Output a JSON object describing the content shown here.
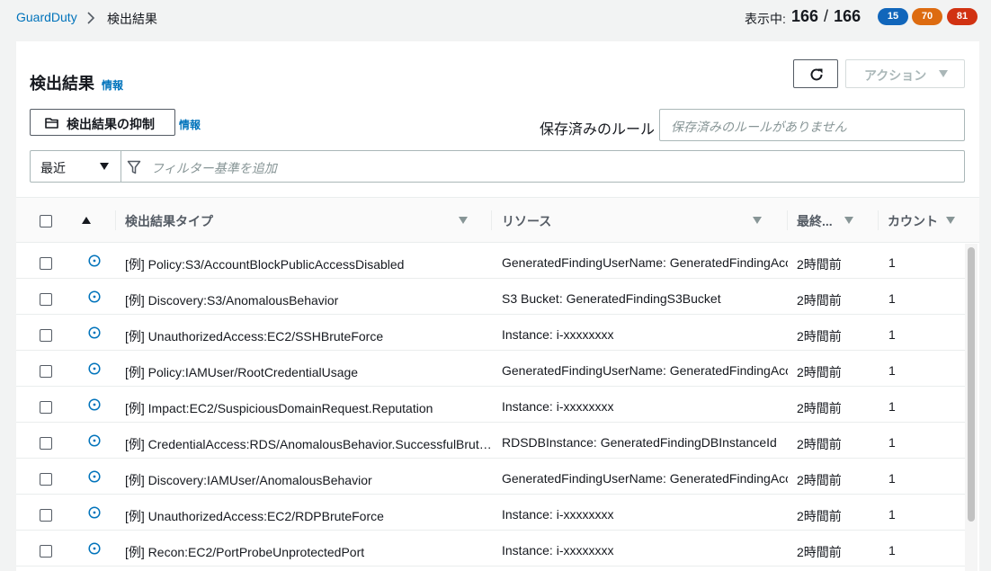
{
  "breadcrumb": {
    "root": "GuardDuty",
    "current": "検出結果"
  },
  "summary": {
    "label": "表示中:",
    "shown": "166",
    "slash": "/",
    "total": "166",
    "badges": {
      "low": "15",
      "medium": "70",
      "high": "81"
    }
  },
  "panel": {
    "title": "検出結果",
    "info": "情報",
    "suppress_button": "検出結果の抑制",
    "suppress_info": "情報",
    "actions_button": "アクション",
    "saved_rules_label": "保存済みのルール",
    "saved_rules_placeholder": "保存済みのルールがありません",
    "filter_select": "最近",
    "filter_placeholder": "フィルター基準を追加"
  },
  "table": {
    "columns": {
      "type": "検出結果タイプ",
      "resource": "リソース",
      "last_seen": "最終...",
      "count": "カウント"
    },
    "rows": [
      {
        "type": "[例] Policy:S3/AccountBlockPublicAccessDisabled",
        "resource": "GeneratedFindingUserName: GeneratedFindingAcc",
        "time": "2時間前",
        "count": "1"
      },
      {
        "type": "[例] Discovery:S3/AnomalousBehavior",
        "resource": "S3 Bucket: GeneratedFindingS3Bucket",
        "time": "2時間前",
        "count": "1"
      },
      {
        "type": "[例] UnauthorizedAccess:EC2/SSHBruteForce",
        "resource": "Instance: i-xxxxxxxx",
        "time": "2時間前",
        "count": "1"
      },
      {
        "type": "[例] Policy:IAMUser/RootCredentialUsage",
        "resource": "GeneratedFindingUserName: GeneratedFindingAcc",
        "time": "2時間前",
        "count": "1"
      },
      {
        "type": "[例] Impact:EC2/SuspiciousDomainRequest.Reputation",
        "resource": "Instance: i-xxxxxxxx",
        "time": "2時間前",
        "count": "1"
      },
      {
        "type": "[例] CredentialAccess:RDS/AnomalousBehavior.SuccessfulBrut…",
        "resource": "RDSDBInstance: GeneratedFindingDBInstanceId",
        "time": "2時間前",
        "count": "1"
      },
      {
        "type": "[例] Discovery:IAMUser/AnomalousBehavior",
        "resource": "GeneratedFindingUserName: GeneratedFindingAcc",
        "time": "2時間前",
        "count": "1"
      },
      {
        "type": "[例] UnauthorizedAccess:EC2/RDPBruteForce",
        "resource": "Instance: i-xxxxxxxx",
        "time": "2時間前",
        "count": "1"
      },
      {
        "type": "[例] Recon:EC2/PortProbeUnprotectedPort",
        "resource": "Instance: i-xxxxxxxx",
        "time": "2時間前",
        "count": "1"
      }
    ]
  },
  "colors": {
    "link": "#0073bb",
    "badge_low": "#1166bb",
    "badge_medium": "#dd6b10",
    "badge_high": "#d13212",
    "severity_icon": "#0073bb"
  },
  "icons": {
    "breadcrumb_separator": "chevron-right-icon",
    "refresh": "refresh-icon",
    "suppress": "folder-icon",
    "filter": "funnel-icon",
    "severity": "info-circle-icon"
  }
}
